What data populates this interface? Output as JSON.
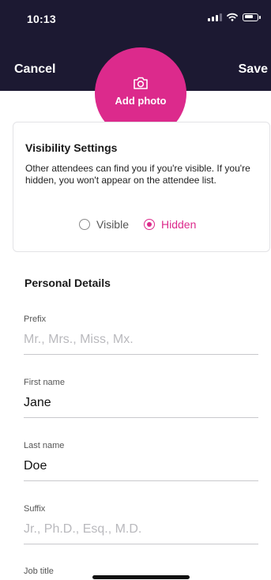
{
  "status_bar": {
    "time": "10:13"
  },
  "header": {
    "cancel_label": "Cancel",
    "save_label": "Save",
    "add_photo_label": "Add photo"
  },
  "visibility": {
    "title": "Visibility Settings",
    "description": "Other attendees can find you if you're visible. If you're hidden, you won't appear on the attendee list.",
    "options": [
      {
        "label": "Visible",
        "selected": false
      },
      {
        "label": "Hidden",
        "selected": true
      }
    ]
  },
  "personal_details": {
    "title": "Personal Details",
    "fields": [
      {
        "label": "Prefix",
        "value": "",
        "placeholder": "Mr., Mrs., Miss, Mx."
      },
      {
        "label": "First name",
        "value": "Jane",
        "placeholder": ""
      },
      {
        "label": "Last name",
        "value": "Doe",
        "placeholder": ""
      },
      {
        "label": "Suffix",
        "value": "",
        "placeholder": "Jr., Ph.D., Esq., M.D."
      },
      {
        "label": "Job title",
        "value": "",
        "placeholder": ""
      }
    ]
  },
  "colors": {
    "accent": "#dc2a8c",
    "header_bg": "#1c1932"
  }
}
